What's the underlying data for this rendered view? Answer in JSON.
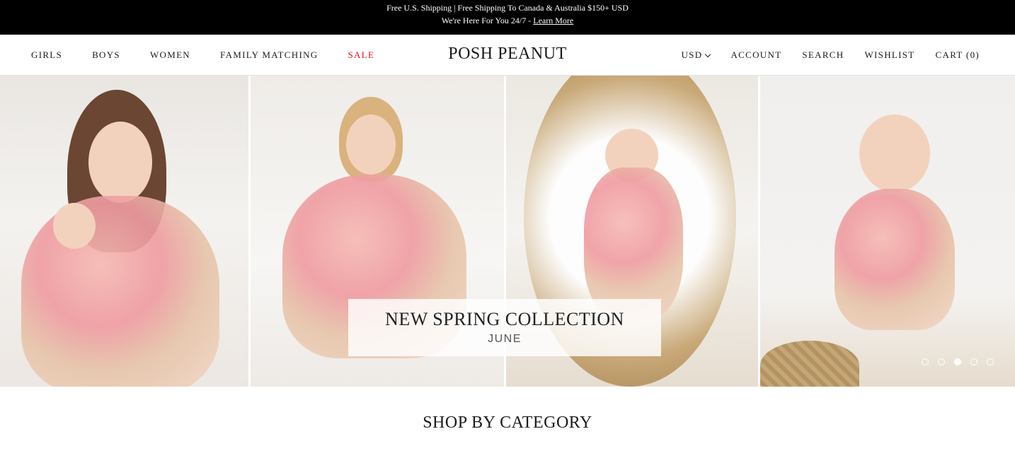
{
  "announcement": {
    "line1": "Free U.S. Shipping | Free Shipping To Canada & Australia $150+ USD",
    "line2_prefix": "We're Here For You 24/7 -",
    "learn_more": "Learn More"
  },
  "header": {
    "nav_left": [
      "GIRLS",
      "BOYS",
      "WOMEN",
      "FAMILY MATCHING",
      "SALE"
    ],
    "logo": "POSH PEANUT",
    "currency": "USD",
    "account": "ACCOUNT",
    "search": "SEARCH",
    "wishlist": "WISHLIST",
    "cart": "CART (0)"
  },
  "hero": {
    "title": "NEW SPRING COLLECTION",
    "subtitle": "JUNE",
    "slide_count": 5,
    "active_slide": 3
  },
  "colors": {
    "sale": "#e0141e",
    "announcement_bg": "#000000"
  },
  "section": {
    "title": "SHOP BY CATEGORY"
  }
}
